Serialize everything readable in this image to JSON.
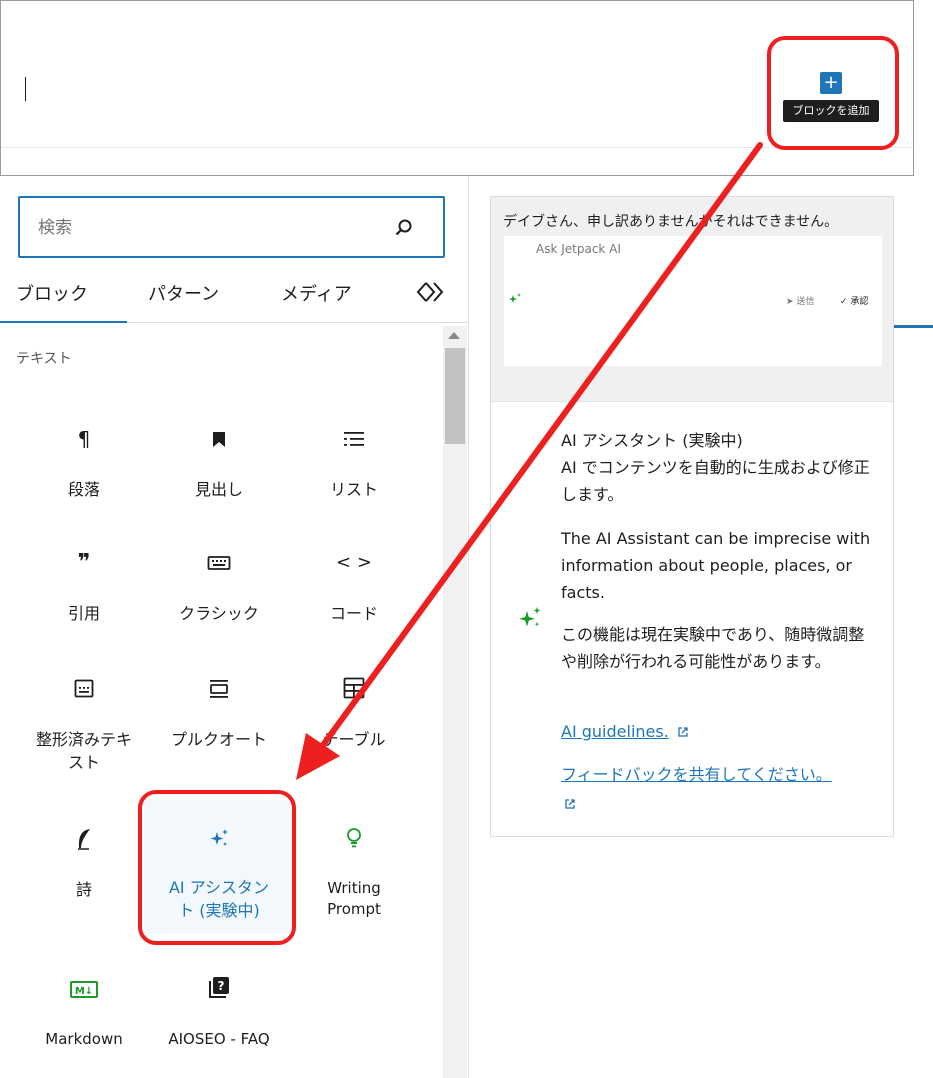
{
  "editor": {
    "tooltip": "ブロックを追加",
    "add_button_icon": "plus-icon"
  },
  "inserter": {
    "search_placeholder": "検索",
    "tabs": [
      "ブロック",
      "パターン",
      "メディア"
    ],
    "active_tab": "ブロック",
    "category": "テキスト",
    "blocks": [
      {
        "label": "段落",
        "icon": "paragraph-icon"
      },
      {
        "label": "見出し",
        "icon": "bookmark-icon"
      },
      {
        "label": "リスト",
        "icon": "list-icon"
      },
      {
        "label": "引用",
        "icon": "quote-icon"
      },
      {
        "label": "クラシック",
        "icon": "keyboard-icon"
      },
      {
        "label": "コード",
        "icon": "code-icon"
      },
      {
        "label": "整形済みテキスト",
        "icon": "preformatted-icon"
      },
      {
        "label": "プルクオート",
        "icon": "pullquote-icon"
      },
      {
        "label": "テーブル",
        "icon": "table-icon"
      },
      {
        "label": "詩",
        "icon": "feather-icon"
      },
      {
        "label": "AI アシスタント (実験中)",
        "icon": "sparkle-icon"
      },
      {
        "label": "Writing Prompt",
        "icon": "lightbulb-icon"
      },
      {
        "label": "Markdown",
        "icon": "markdown-icon"
      },
      {
        "label": "AIOSEO - FAQ",
        "icon": "faq-icon"
      }
    ]
  },
  "preview": {
    "response_text": "デイブさん、申し訳ありませんがそれはできません。",
    "card_title": "Ask Jetpack AI",
    "send_label": "送信",
    "approve_label": "承認"
  },
  "info": {
    "title": "AI アシスタント (実験中)",
    "description": "AI でコンテンツを自動的に生成および修正します。",
    "warning": "The AI Assistant can be imprecise with information about people, places, or facts.",
    "experimental": "この機能は現在実験中であり、随時微調整や削除が行われる可能性があります。",
    "guidelines_link": "AI guidelines.",
    "feedback_link": "フィードバックを共有してください。"
  },
  "colors": {
    "accent": "#1f75b8",
    "highlight_red": "#ee1f1f",
    "sparkle_green": "#1a9b2c"
  }
}
